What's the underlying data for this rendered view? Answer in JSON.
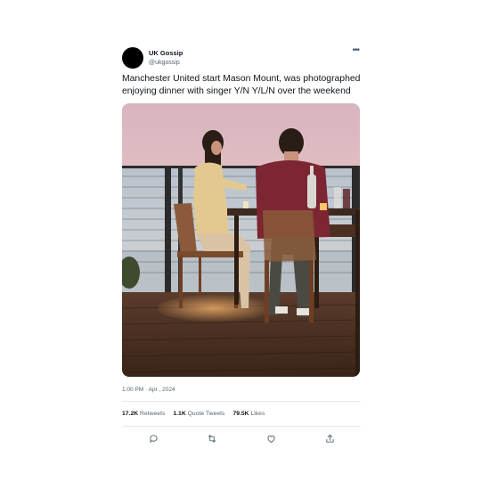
{
  "account": {
    "display_name": "UK Gossip",
    "handle": "@ukgossip"
  },
  "tweet": {
    "text": "Manchester United start Mason Mount, was photographed enjoying dinner with singer Y/N Y/L/N over the weekend",
    "timestamp": "1:00 PM · Apr , 2024"
  },
  "stats": {
    "retweets_count": "17.2K",
    "retweets_label": "Retweets",
    "quotes_count": "1.1K",
    "quotes_label": "Quote Tweets",
    "likes_count": "79.5K",
    "likes_label": "Likes"
  },
  "icons": {
    "more": "more-horizontal-icon",
    "reply": "reply-icon",
    "retweet": "retweet-icon",
    "like": "heart-icon",
    "share": "share-icon"
  },
  "colors": {
    "text": "#0f1419",
    "secondary": "#536471",
    "divider": "#e6e9ea",
    "avatar": "#000000"
  }
}
